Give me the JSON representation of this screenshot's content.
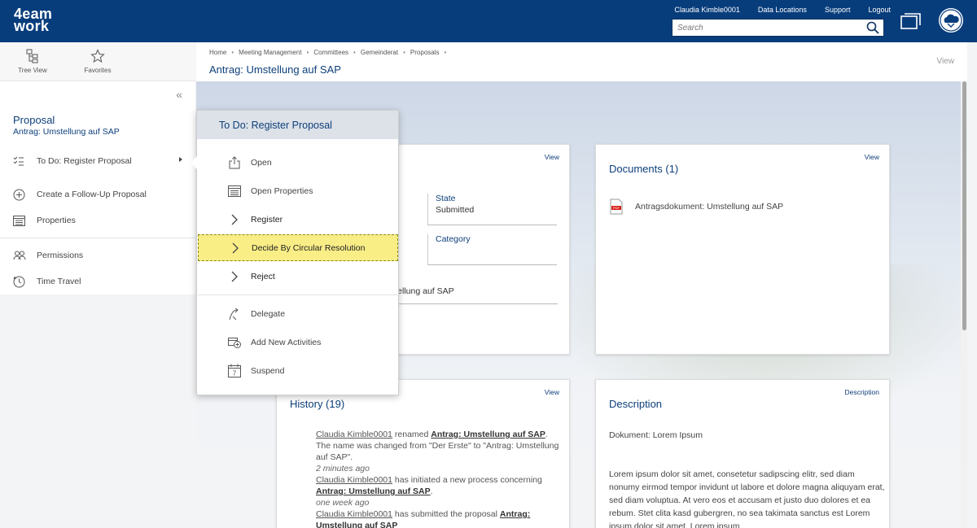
{
  "topbar": {
    "logo_line1": "4eam",
    "logo_line2": "work",
    "user": "Claudia Kimble0001",
    "links": [
      "Data Locations",
      "Support",
      "Logout"
    ],
    "search_placeholder": "Search"
  },
  "sidebar": {
    "tools": [
      "Tree View",
      "Favorites"
    ],
    "collapse": "«",
    "process_title": "Proposal",
    "process_subtitle": "Antrag: Umstellung auf SAP",
    "items": [
      {
        "label": "To Do: Register Proposal",
        "icon": "task-list-icon"
      },
      {
        "label": "Create a Follow-Up Proposal",
        "icon": "plus-circle-icon"
      },
      {
        "label": "Properties",
        "icon": "properties-icon"
      },
      {
        "label": "Permissions",
        "icon": "people-icon"
      },
      {
        "label": "Time Travel",
        "icon": "clock-icon"
      }
    ]
  },
  "header": {
    "breadcrumbs": [
      "Home",
      "Meeting Management",
      "Committees",
      "Gemeinderat",
      "Proposals"
    ],
    "title": "Antrag: Umstellung auf SAP",
    "view": "View"
  },
  "popup": {
    "title": "To Do: Register Proposal",
    "items": [
      {
        "label": "Open",
        "icon": "open-icon"
      },
      {
        "label": "Open Properties",
        "icon": "properties-icon"
      },
      {
        "label": "Register",
        "icon": "chevron-right-icon"
      },
      {
        "label": "Decide By Circular Resolution",
        "icon": "chevron-right-icon"
      },
      {
        "label": "Reject",
        "icon": "chevron-right-icon"
      },
      {
        "label": "Delegate",
        "icon": "delegate-icon"
      },
      {
        "label": "Add New Activities",
        "icon": "add-activity-icon"
      },
      {
        "label": "Suspend",
        "icon": "calendar-icon"
      }
    ],
    "calendar_day": "7"
  },
  "details_card": {
    "view": "View",
    "state_label": "State",
    "state_value": "Submitted",
    "category_label": "Category",
    "subject_partial": "stellung auf SAP"
  },
  "documents_card": {
    "title": "Documents (1)",
    "view": "View",
    "doc_name": "Antragsdokument: Umstellung auf SAP"
  },
  "history_card": {
    "title": "History (19)",
    "view": "View",
    "entries": [
      {
        "user": "Claudia Kimble0001",
        "action": " renamed ",
        "object": "Antrag: Umstellung auf SAP",
        "detail": ". The name was changed from \"Der Erste\" to \"Antrag: Umstellung auf SAP\".",
        "time": "2 minutes ago"
      },
      {
        "user": "Claudia Kimble0001",
        "action": " has initiated a new process concerning ",
        "object": "Antrag: Umstellung auf SAP",
        "detail": ".",
        "time": "one week ago"
      },
      {
        "user": "Claudia Kimble0001",
        "action": " has submitted the proposal ",
        "object": "Antrag: Umstellung auf SAP",
        "detail": "",
        "time": ""
      }
    ]
  },
  "description_card": {
    "title": "Description",
    "link": "Description",
    "subtitle": "Dokument: Lorem Ipsum",
    "body": "Lorem ipsum dolor sit amet, consetetur sadipscing elitr, sed diam nonumy eirmod tempor invidunt ut labore et dolore magna aliquyam erat, sed diam voluptua. At vero eos et accusam et justo duo dolores et ea rebum. Stet clita kasd gubergren, no sea takimata sanctus est Lorem ipsum dolor sit amet. Lorem ipsum"
  },
  "colors": {
    "brand": "#083d7c",
    "link": "#0d3f7a",
    "highlight": "#f9ed86"
  }
}
